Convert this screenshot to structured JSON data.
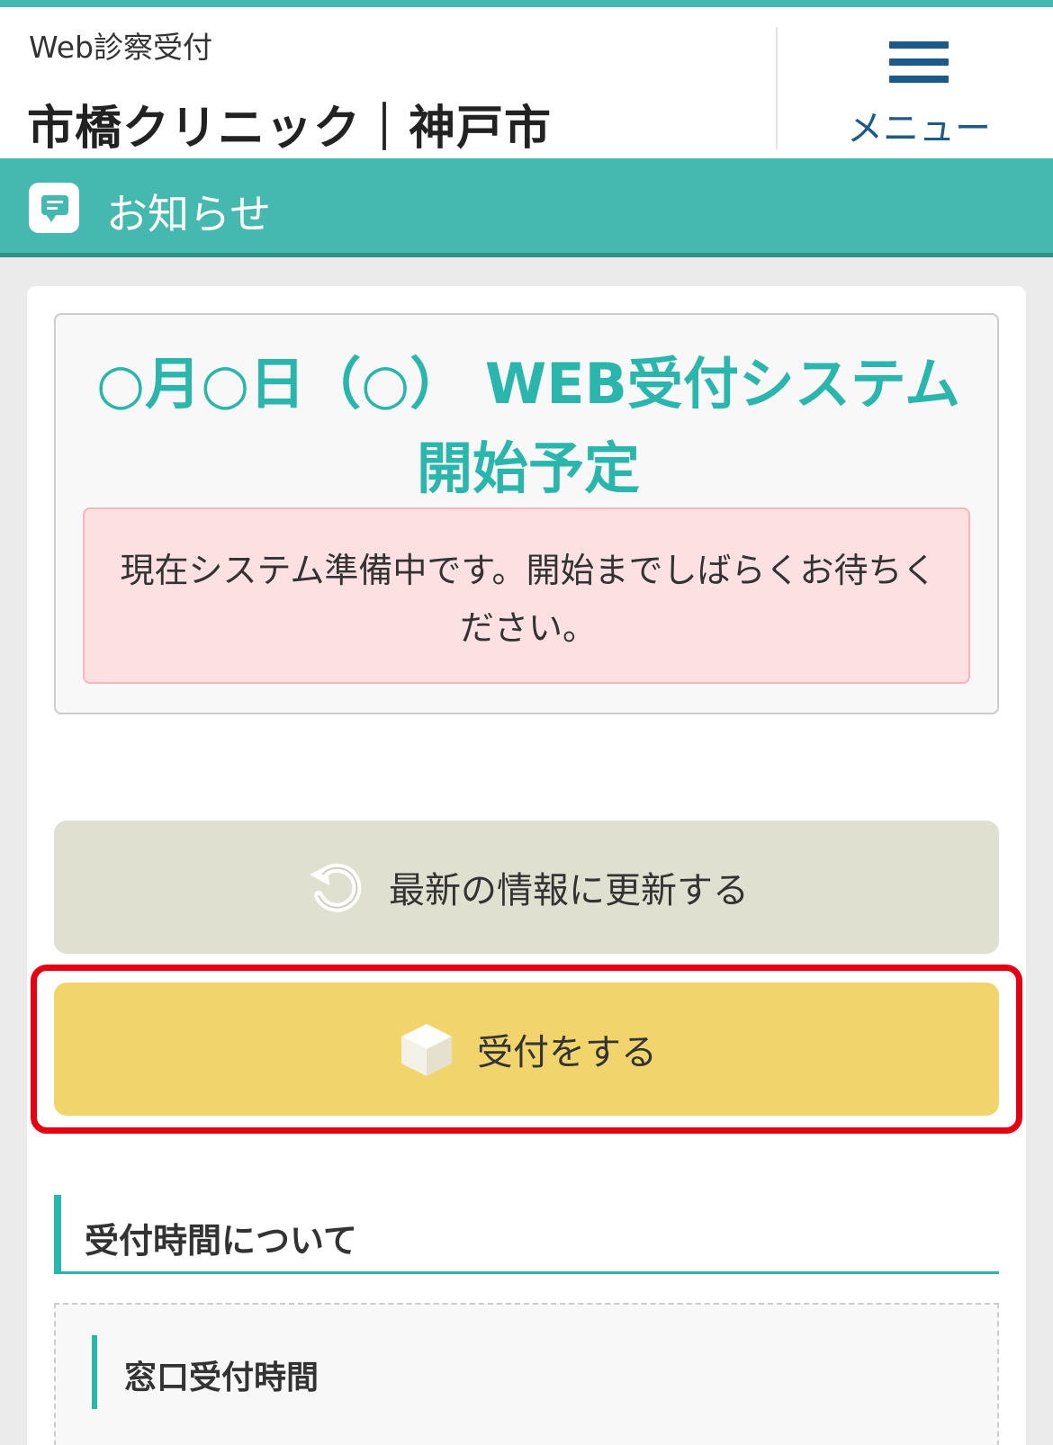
{
  "header": {
    "subtitle": "Web診察受付",
    "clinic_name": "市橋クリニック｜神戸市",
    "menu_label": "メニュー",
    "menu_icon": "hamburger-icon"
  },
  "notice_bar": {
    "title": "お知らせ",
    "icon": "chat-bubble-icon"
  },
  "announcement": {
    "title": "○月○日（○） WEB受付システム開始予定",
    "alert_text": "現在システム準備中です。開始までしばらくお待ちください。"
  },
  "buttons": {
    "refresh_label": "最新の情報に更新する",
    "refresh_icon": "refresh-icon",
    "reserve_label": "受付をする",
    "reserve_icon": "box-icon"
  },
  "sections": {
    "reception_hours_heading": "受付時間について",
    "counter_hours_heading": "窓口受付時間"
  },
  "colors": {
    "teal": "#45b8b0",
    "title_teal": "#2ab5ad",
    "menu_blue": "#1d5a8a",
    "alert_pink": "#fde0e2",
    "reserve_yellow": "#f1d56c",
    "refresh_gray": "#e0e0d1",
    "highlight_red": "#e60012"
  }
}
